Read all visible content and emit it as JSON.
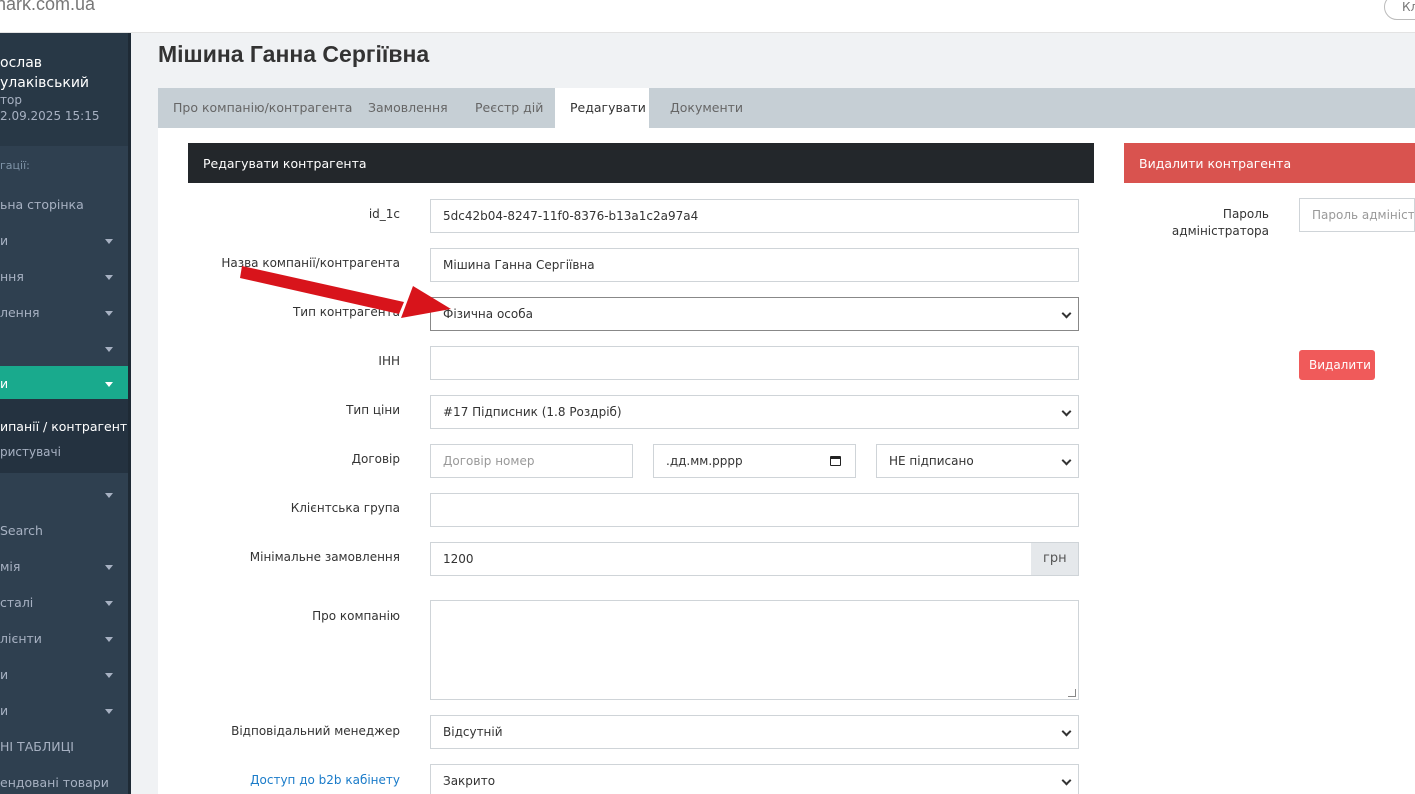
{
  "browser": {
    "url": "nark.com.ua",
    "pill": "Кл"
  },
  "sidebar": {
    "user_name_line1": "ослав",
    "user_name_line2": "улаківський",
    "user_role": "тор",
    "user_date": "2.09.2025 15:15",
    "nav_heading": "гації:",
    "items": [
      {
        "label": "ьна сторінка"
      },
      {
        "label": "и"
      },
      {
        "label": "ння"
      },
      {
        "label": "лення"
      },
      {
        "label": ""
      },
      {
        "label": "и"
      },
      {
        "label": ""
      },
      {
        "label": "Search"
      },
      {
        "label": "мія"
      },
      {
        "label": "сталі"
      },
      {
        "label": "лієнти"
      },
      {
        "label": "и"
      },
      {
        "label": "и"
      },
      {
        "label": "НІ ТАБЛИЦІ"
      },
      {
        "label": "ендовані товари"
      }
    ],
    "sub_active": "ипанії / контрагенти",
    "sub_other": "ристувачі"
  },
  "page": {
    "title": "Мішина Ганна Сергіївна",
    "tabs": [
      {
        "label": "Про компанію/контрагента"
      },
      {
        "label": "Замовлення"
      },
      {
        "label": "Реєстр дій"
      },
      {
        "label": "Редагувати"
      },
      {
        "label": "Документи"
      }
    ]
  },
  "edit": {
    "header": "Редагувати контрагента",
    "id_label": "id_1c",
    "id_value": "5dc42b04-8247-11f0-8376-b13a1c2a97a4",
    "name_label": "Назва компанії/контрагента",
    "name_value": "Мішина Ганна Сергіївна",
    "type_label": "Тип контрагента",
    "type_value": "Фізична особа",
    "inn_label": "ІНН",
    "price_label": "Тип ціни",
    "price_value": "#17 Підписник (1.8 Роздріб)",
    "contract_label": "Договір",
    "contract_placeholder": "Договір номер",
    "contract_date": ".дд.мм.рррр",
    "contract_status": "НЕ підписано",
    "group_label": "Клієнтська група",
    "min_order_label": "Мінімальне замовлення",
    "min_order_value": "1200",
    "currency": "грн",
    "about_label": "Про компанію",
    "manager_label": "Відповідальний менеджер",
    "manager_value": "Відсутній",
    "b2b_label": "Доступ до b2b кабінету",
    "b2b_value": "Закрито"
  },
  "delete": {
    "header": "Видалити контрагента",
    "password_label_line1": "Пароль",
    "password_label_line2": "адміністратора",
    "password_placeholder": "Пароль адміністратора",
    "button": "Видалити"
  },
  "colors": {
    "sidebar": "#2f4050",
    "active_nav": "#19aa8d",
    "dark_header": "#23272b",
    "red_header": "#d9534f",
    "delete_button": "#f05a5a",
    "arrow": "#d8141b",
    "link": "#1a7bc9"
  }
}
